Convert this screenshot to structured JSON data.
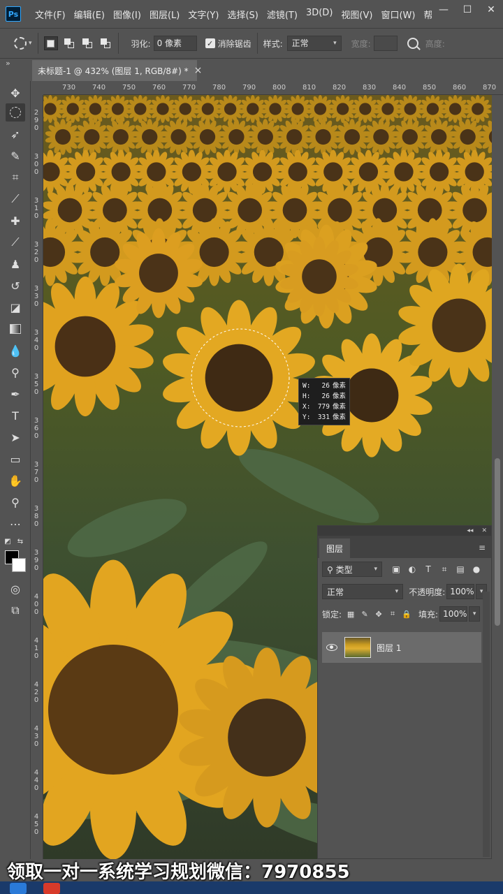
{
  "app": {
    "logo": "Ps"
  },
  "menu": [
    "文件(F)",
    "编辑(E)",
    "图像(I)",
    "图层(L)",
    "文字(Y)",
    "选择(S)",
    "滤镜(T)",
    "3D(D)",
    "视图(V)",
    "窗口(W)",
    "帮助"
  ],
  "window_controls": {
    "minimize": "—",
    "restore": "☐",
    "close": "✕"
  },
  "options": {
    "feather_label": "羽化:",
    "feather_value": "0 像素",
    "antialias_label": "消除锯齿",
    "antialias_checked": "✓",
    "style_label": "样式:",
    "style_value": "正常",
    "width_label": "宽度:",
    "height_label": "高度:"
  },
  "document_tab": {
    "title": "未标题-1 @ 432% (图层 1, RGB/8#) *",
    "close": "×"
  },
  "ruler": {
    "h_ticks": [
      "730",
      "740",
      "750",
      "760",
      "770",
      "780",
      "790",
      "800",
      "810",
      "820",
      "830",
      "840",
      "850",
      "860",
      "870"
    ],
    "v_ticks": [
      "290",
      "300",
      "310",
      "320",
      "330",
      "340",
      "350",
      "360",
      "370",
      "380",
      "390",
      "400",
      "410",
      "420",
      "430",
      "440",
      "450"
    ]
  },
  "selection_info": {
    "w_label": "W:",
    "w_value": "26",
    "w_unit": "像素",
    "h_label": "H:",
    "h_value": "26",
    "h_unit": "像素",
    "x_label": "X:",
    "x_value": "779",
    "x_unit": "像素",
    "y_label": "Y:",
    "y_value": "331",
    "y_unit": "像素"
  },
  "layers_panel": {
    "tab": "图层",
    "filter_type": "类型",
    "blend_mode": "正常",
    "opacity_label": "不透明度:",
    "opacity_value": "100%",
    "lock_label": "锁定:",
    "fill_label": "填充:",
    "fill_value": "100%",
    "layers": [
      {
        "name": "图层 1",
        "visible": true
      }
    ]
  },
  "caption": "领取一对一系统学习规划微信：7970855",
  "colors": {
    "foreground": "#000000",
    "background": "#ffffff",
    "ui_bg": "#535353",
    "panel_dark": "#3e3e3e"
  }
}
